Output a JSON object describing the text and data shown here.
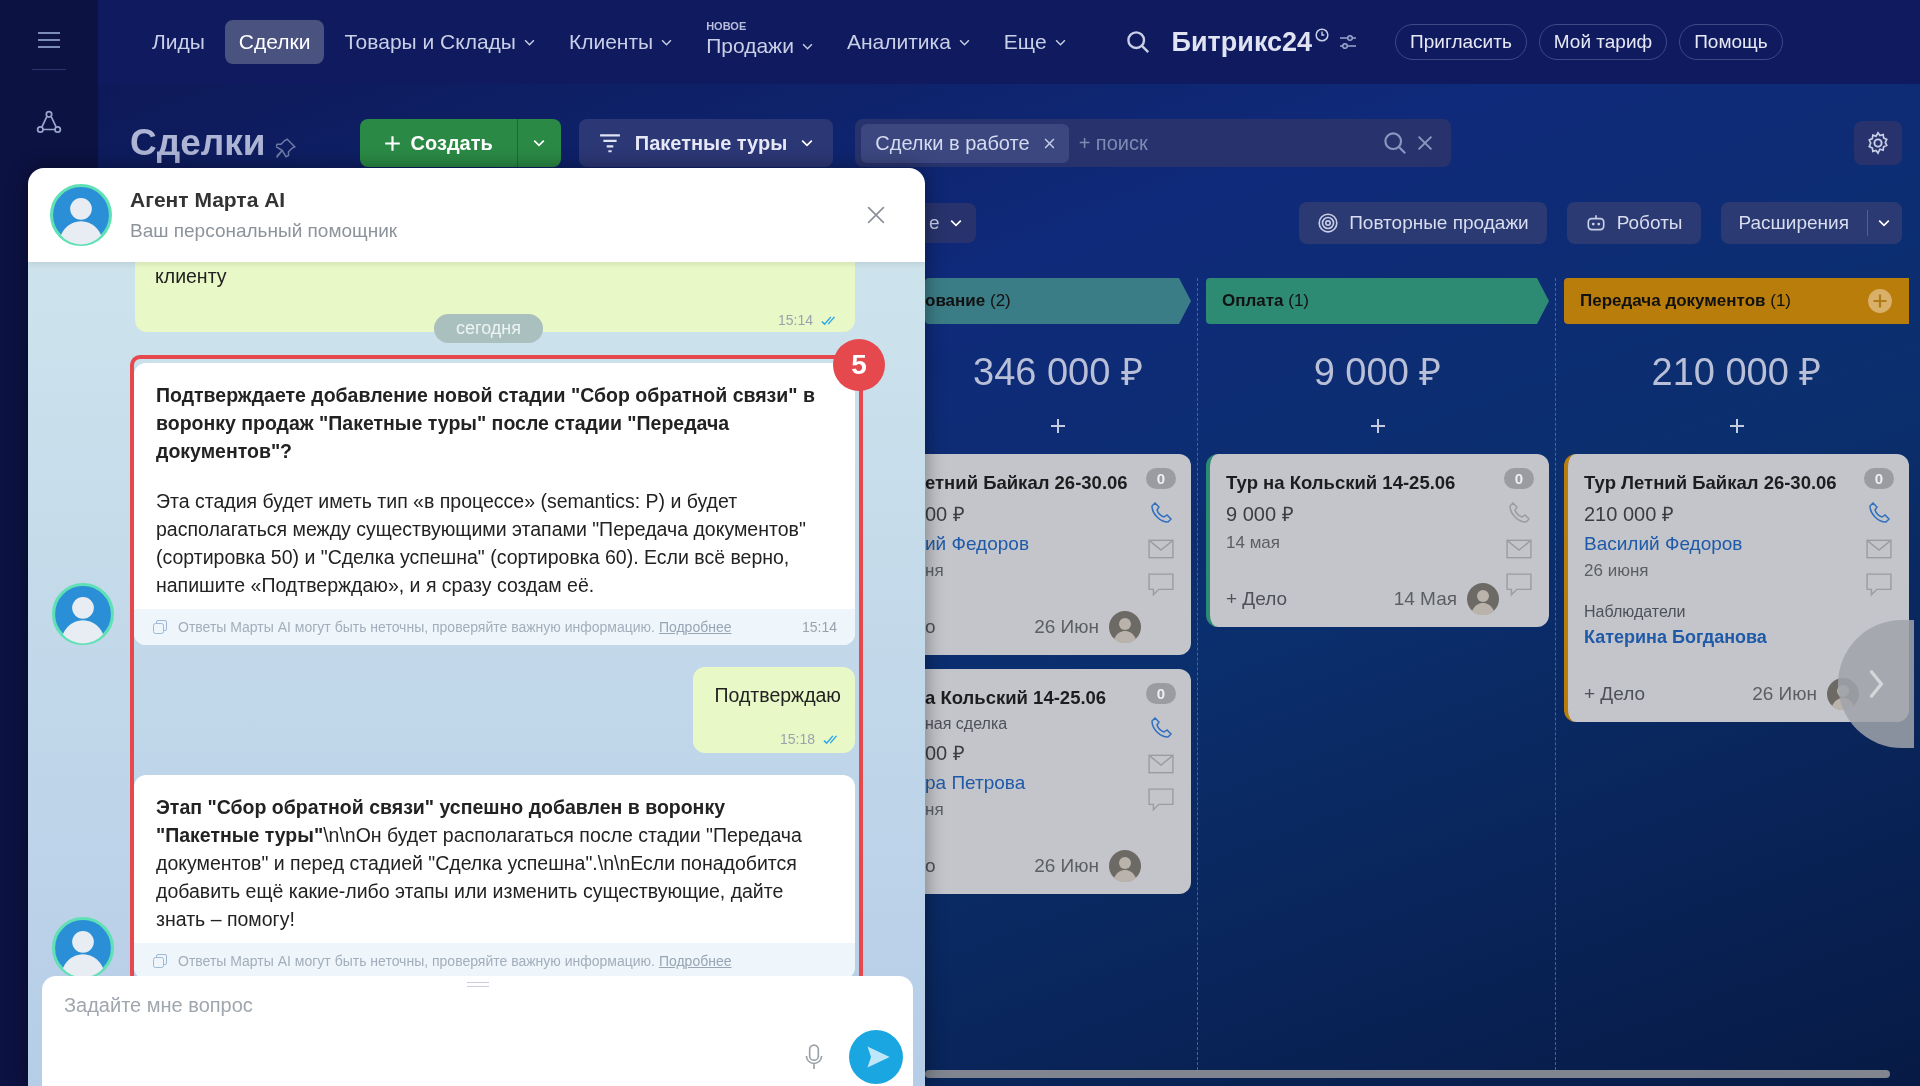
{
  "top_nav": {
    "items": [
      {
        "label": "Лиды",
        "selected": false,
        "dropdown": false
      },
      {
        "label": "Сделки",
        "selected": true,
        "dropdown": false
      },
      {
        "label": "Товары и Склады",
        "selected": false,
        "dropdown": true
      },
      {
        "label": "Клиенты",
        "selected": false,
        "dropdown": true
      },
      {
        "label": "Продажи",
        "selected": false,
        "dropdown": true,
        "badge": "НОВОЕ"
      },
      {
        "label": "Аналитика",
        "selected": false,
        "dropdown": true
      },
      {
        "label": "Еще",
        "selected": false,
        "dropdown": true
      }
    ],
    "brand": "Битрикс24",
    "buttons": [
      "Пригласить",
      "Мой тариф",
      "Помощь"
    ]
  },
  "toolbar": {
    "title": "Сделки",
    "create_button": "Создать",
    "pipeline": "Пакетные туры",
    "filter_tag": "Сделки в работе",
    "search_placeholder": "+ поиск"
  },
  "secondary_toolbar": {
    "partial_filter": "е",
    "buttons": [
      {
        "label": "Повторные продажи",
        "kind": "repeat"
      },
      {
        "label": "Роботы",
        "kind": "robot"
      },
      {
        "label": "Расширения",
        "kind": "split"
      }
    ]
  },
  "kanban": {
    "columns": [
      {
        "title": "ование",
        "count": "(2)",
        "color": "#3b7d86",
        "sum": "346 000 ₽",
        "add_button": false,
        "cards": [
          {
            "title": "етний Байкал 26-30.06",
            "amount": "00 ₽",
            "contact": "ий Федоров",
            "date": "ня",
            "counter": "0",
            "phone_active": true,
            "add_task": "о",
            "due": "26 Июн"
          },
          {
            "title": "а Кольский 14-25.06",
            "subtitle": "ная сделка",
            "amount": "00 ₽",
            "contact": "ра Петрова",
            "date": "ня",
            "counter": "0",
            "phone_active": true,
            "add_task": "о",
            "due": "26 Июн"
          }
        ]
      },
      {
        "title": "Оплата",
        "count": "(1)",
        "color": "#2d8a73",
        "sum": "9 000 ₽",
        "add_button": false,
        "cards": [
          {
            "title": "Тур на Кольский 14-25.06",
            "amount": "9 000 ₽",
            "date": "14 мая",
            "counter": "0",
            "phone_active": false,
            "add_task": "+ Дело",
            "due": "14 Мая"
          }
        ]
      },
      {
        "title": "Передача документов",
        "count": "(1)",
        "color": "#b97d0c",
        "sum": "210 000 ₽",
        "add_button": true,
        "cards": [
          {
            "title": "Тур Летний Байкал 26-30.06",
            "amount": "210 000 ₽",
            "contact": "Василий Федоров",
            "date": "26 июня",
            "observers_label": "Наблюдатели",
            "observer": "Катерина Богданова",
            "counter": "0",
            "phone_active": true,
            "add_task": "+ Дело",
            "due": "26 Июн"
          }
        ]
      }
    ]
  },
  "chat": {
    "title": "Агент Марта AI",
    "subtitle": "Ваш персональный помощник",
    "date_divider": "сегодня",
    "messages": [
      {
        "kind": "user",
        "paragraphs": [
          {
            "text": "клиенту",
            "bold": false
          }
        ],
        "time": "15:14",
        "read": true
      },
      {
        "kind": "bot",
        "paragraphs": [
          {
            "text": "Подтверждаете добавление новой стадии \"Сбор обратной связи\" в воронку продаж \"Пакетные туры\" после стадии \"Передача документов\"?",
            "bold": true
          },
          {
            "text": "Эта стадия будет иметь тип «в процессе» (semantics: P) и будет располагаться между существующими этапами \"Передача документов\" (сортировка 50) и \"Сделка успешна\" (сортировка 60). Если всё верно, напишите «Подтверждаю», и я сразу создам её.",
            "bold": false
          }
        ],
        "disclaimer": "Ответы Марты AI могут быть неточны, проверяйте важную информацию.",
        "link": "Подробнее",
        "time": "15:14"
      },
      {
        "kind": "user",
        "paragraphs": [
          {
            "text": "Подтверждаю",
            "bold": false
          }
        ],
        "time": "15:18",
        "read": true
      },
      {
        "kind": "bot",
        "paragraphs": [
          {
            "text": "**Этап \"Сбор обратной связи\" успешно добавлен в воронку \"Пакетные туры\"**\\n\\nОн будет располагаться после стадии \"Передача документов\" и перед стадией \"Сделка успешна\".\\n\\nЕсли понадобится добавить ещё какие-либо этапы или изменить существующие, дайте знать – помогу!",
            "bold": false
          }
        ],
        "disclaimer": "Ответы Марты AI могут быть неточны, проверяйте важную информацию.",
        "link": "Подробнее"
      }
    ],
    "highlight_badge": "5",
    "input_placeholder": "Задайте мне вопрос"
  }
}
